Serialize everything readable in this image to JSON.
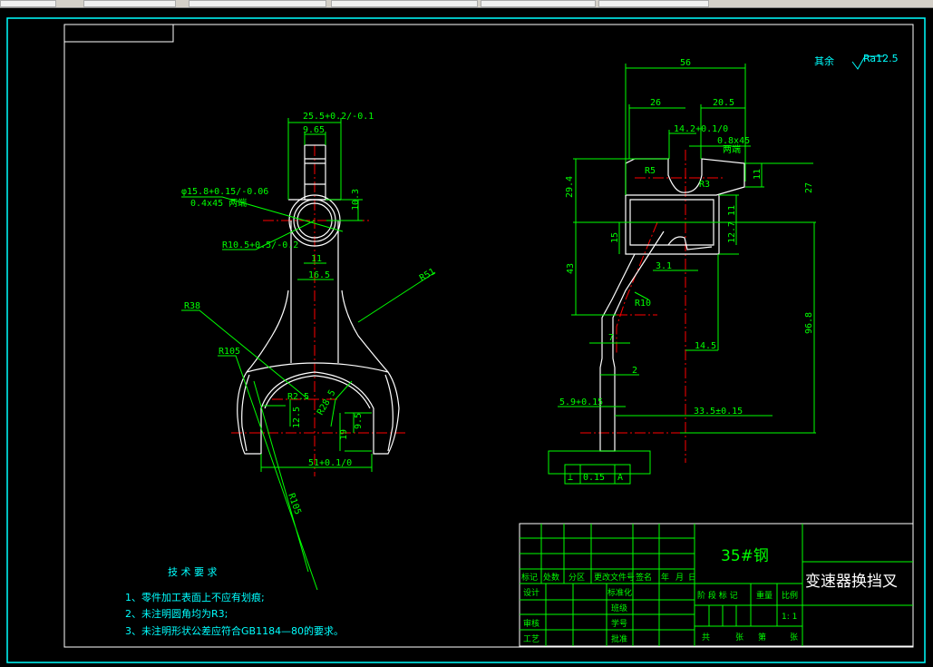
{
  "colors": {
    "dimension": "#00ff00",
    "outline": "#ffffff",
    "centerline": "#ff0000",
    "notes": "#00ffff",
    "background": "#000000"
  },
  "roughness": {
    "prefix": "其余",
    "value": "Ra12.5"
  },
  "left_view": {
    "dims": [
      "25.5+0.2/-0.1",
      "9.65",
      "φ15.8+0.15/-0.06",
      "0.4x45 两端",
      "R10.5+0.5/-0.2",
      "10.3",
      "11",
      "16.5",
      "R51",
      "R38",
      "R105",
      "R2.5",
      "R28.5",
      "12.5",
      "9.5",
      "19",
      "51+0.1/0",
      "R105"
    ]
  },
  "right_view": {
    "dims": [
      "56",
      "26",
      "20.5",
      "14.2+0.1/0",
      "0.8x45",
      "两端",
      "R5",
      "R3",
      "29.4",
      "11",
      "27",
      "11",
      "12.7",
      "15",
      "43",
      "3.1",
      "R10",
      "14.5",
      "96.8",
      "2",
      "5.9+0.15",
      "7",
      "33.5±0.15"
    ],
    "tolerance_frame": {
      "symbol": "⊥",
      "value": "0.15",
      "datum": "A"
    }
  },
  "tech_requirements": {
    "title": "技 术 要 求",
    "items": [
      "1、零件加工表面上不应有划痕;",
      "2、未注明圆角均为R3;",
      "3、未注明形状公差应符合GB1184—80的要求。"
    ]
  },
  "title_block": {
    "material": "35#钢",
    "part_name": "变速器换挡叉",
    "rev_headers": [
      "标记",
      "处数",
      "分区",
      "更改文件号",
      "签名",
      "年",
      "月",
      "日"
    ],
    "roles": [
      "设计",
      "审核",
      "工艺"
    ],
    "roles2": [
      "标准化",
      "班级",
      "学号",
      "批准"
    ],
    "stage_label": "阶 段 标 记",
    "weight_label": "重量",
    "scale_label": "比例",
    "scale": "1: 1",
    "sheets": [
      "共",
      "张",
      "第",
      "张"
    ]
  }
}
